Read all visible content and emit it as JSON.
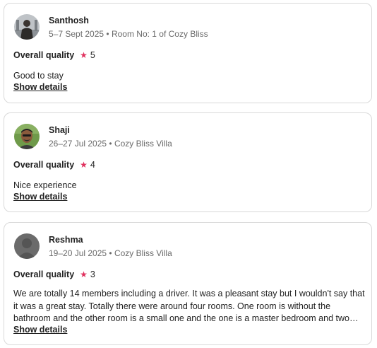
{
  "reviews": [
    {
      "name": "Santhosh",
      "meta": "5–7 Sept 2025 • Room No: 1 of Cozy Bliss",
      "quality_label": "Overall quality",
      "rating": "5",
      "comment": "Good to stay",
      "show_details": "Show details",
      "avatar": "profile-photo"
    },
    {
      "name": "Shaji",
      "meta": "26–27 Jul 2025 • Cozy Bliss Villa",
      "quality_label": "Overall quality",
      "rating": "4",
      "comment": "Nice experience",
      "show_details": "Show details",
      "avatar": "profile-photo"
    },
    {
      "name": "Reshma",
      "meta": "19–20 Jul 2025 • Cozy Bliss Villa",
      "quality_label": "Overall quality",
      "rating": "3",
      "comment": "We are totally 14 members including a driver. It was a pleasant stay but I wouldn't say that it was a great stay. Totally there were around four rooms. One room is without the bathroom and the other room is a small one and the one is a master bedroom and two rooms are ther...",
      "show_details": "Show details",
      "avatar": "default-avatar"
    }
  ],
  "colors": {
    "star": "#e0315e",
    "text": "#222222",
    "meta": "#6a6a6a",
    "border": "#d9d9d9"
  },
  "icons": {
    "star": "star-icon"
  }
}
